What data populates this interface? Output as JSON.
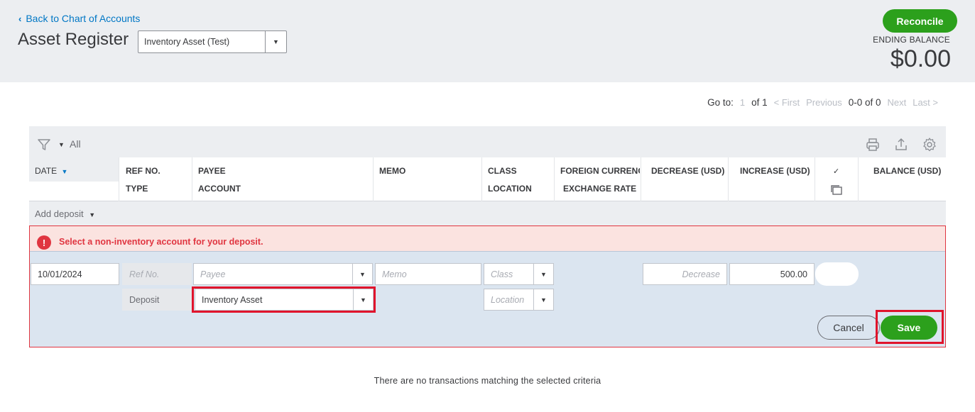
{
  "header": {
    "back_link": "Back to Chart of Accounts",
    "title": "Asset Register",
    "account_selected": "Inventory Asset (Test)",
    "reconcile_label": "Reconcile",
    "ending_balance_label": "ENDING BALANCE",
    "ending_balance_value": "$0.00"
  },
  "pager": {
    "goto_label": "Go to:",
    "page_input": "1",
    "of_label": "of 1",
    "first": "< First",
    "previous": "Previous",
    "range": "0-0 of 0",
    "next": "Next",
    "last": "Last >"
  },
  "toolbar": {
    "filter_value": "All",
    "icons": [
      "filter-icon",
      "print-icon",
      "export-icon",
      "settings-icon"
    ]
  },
  "columns": {
    "date": "DATE",
    "ref_no": "REF NO.",
    "type": "TYPE",
    "payee": "PAYEE",
    "account": "ACCOUNT",
    "memo": "MEMO",
    "class": "CLASS",
    "location": "LOCATION",
    "foreign_currency": "FOREIGN CURRENC",
    "exchange_rate": "EXCHANGE RATE",
    "decrease": "DECREASE (USD)",
    "increase": "INCREASE (USD)",
    "cleared_mark": "✓",
    "balance": "BALANCE (USD)"
  },
  "add_deposit_label": "Add deposit",
  "error_message": "Select a non-inventory account for your deposit.",
  "edit_row": {
    "date": "10/01/2024",
    "ref_placeholder": "Ref No.",
    "payee_placeholder": "Payee",
    "memo_placeholder": "Memo",
    "class_placeholder": "Class",
    "decrease_placeholder": "Decrease",
    "increase": "500.00",
    "type": "Deposit",
    "account": "Inventory Asset",
    "location_placeholder": "Location",
    "cancel_label": "Cancel",
    "save_label": "Save"
  },
  "empty_message": "There are no transactions matching the selected criteria",
  "colors": {
    "accent_green": "#2ca01c",
    "link_blue": "#0077c5",
    "error_red": "#e03540",
    "highlight_red": "#e0142c"
  }
}
